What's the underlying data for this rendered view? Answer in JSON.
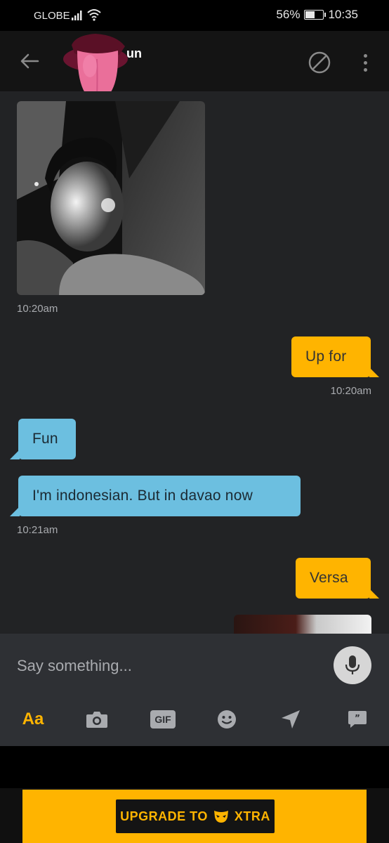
{
  "status_bar": {
    "carrier": "GLOBE",
    "battery_text": "56%",
    "battery_level": 0.56,
    "time": "10:35"
  },
  "header": {
    "profile_name_partial": "un"
  },
  "messages": [
    {
      "type": "photo",
      "direction": "in",
      "time": "10:20am"
    },
    {
      "type": "text",
      "direction": "out",
      "text": "Up for",
      "time": "10:20am"
    },
    {
      "type": "text",
      "direction": "in",
      "text": "Fun"
    },
    {
      "type": "text",
      "direction": "in",
      "text": "I'm indonesian.  But in davao now",
      "time": "10:21am"
    },
    {
      "type": "text",
      "direction": "out",
      "text": "Versa"
    },
    {
      "type": "photo",
      "direction": "out"
    }
  ],
  "composer": {
    "placeholder": "Say something...",
    "format_label": "Aa",
    "gif_label": "GIF"
  },
  "banner": {
    "upgrade_text": "UPGRADE TO",
    "brand_text": "XTRA"
  },
  "colors": {
    "accent": "#ffb400",
    "incoming_bubble": "#6cbfe0",
    "chat_background": "#222325",
    "composer_background": "#2e3034"
  },
  "icons": [
    "signal-icon",
    "wifi-icon",
    "battery-icon",
    "back-arrow-icon",
    "block-icon",
    "more-options-icon",
    "microphone-icon",
    "camera-icon",
    "emoji-icon",
    "location-icon",
    "saved-phrases-icon",
    "mask-icon"
  ]
}
